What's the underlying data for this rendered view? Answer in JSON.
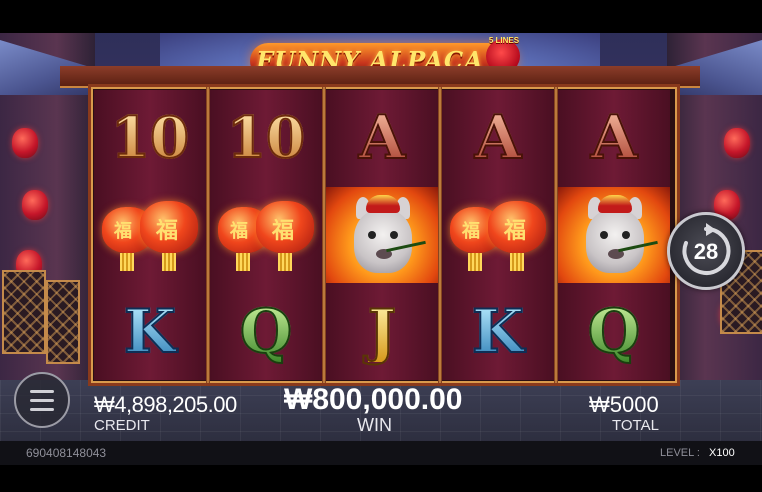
{
  "game": {
    "title": "FUNNY ALPACA",
    "lines_badge": "5 LINES"
  },
  "reels": [
    [
      "10",
      "lantern",
      "K"
    ],
    [
      "10",
      "lantern",
      "Q"
    ],
    [
      "A",
      "alpaca",
      "J"
    ],
    [
      "A",
      "lantern",
      "K"
    ],
    [
      "A",
      "alpaca",
      "Q"
    ]
  ],
  "lantern_glyph": "福",
  "autospin": {
    "count": "28",
    "icon": "rotate-arrow-icon"
  },
  "menu": {
    "icon": "hamburger-menu-icon"
  },
  "credit": {
    "value": "₩4,898,205.00",
    "label": "CREDIT"
  },
  "win": {
    "value": "₩800,000.00",
    "label": "WIN"
  },
  "total": {
    "value": "₩5000",
    "label": "TOTAL"
  },
  "footer": {
    "id": "690408148043",
    "level_label": "LEVEL :",
    "level_value": "X100"
  },
  "colors": {
    "reel_bg": "#6e1a35",
    "frame_gold": "#d99a4c",
    "accent_red": "#c5162a"
  }
}
